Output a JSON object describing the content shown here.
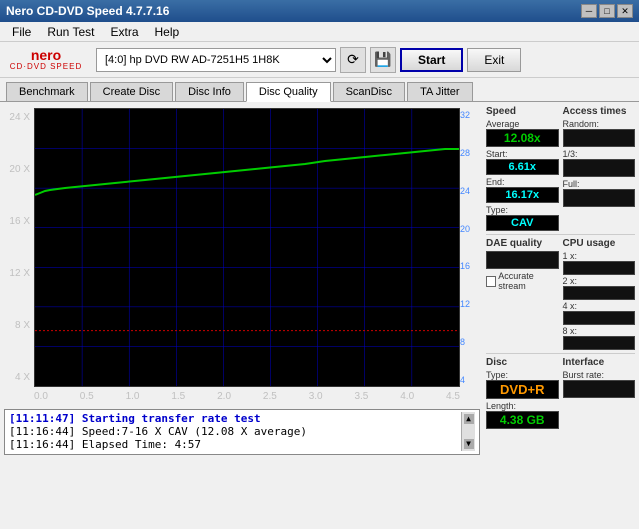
{
  "titleBar": {
    "text": "Nero CD-DVD Speed 4.7.7.16",
    "controls": [
      "minimize",
      "maximize",
      "close"
    ]
  },
  "menuBar": {
    "items": [
      "File",
      "Run Test",
      "Extra",
      "Help"
    ]
  },
  "toolbar": {
    "logo": "CD-DVD SPEED",
    "driveLabel": "[4:0]  hp DVD RW AD-7251H5 1H8K",
    "startLabel": "Start",
    "exitLabel": "Exit"
  },
  "tabs": [
    {
      "label": "Benchmark",
      "active": false
    },
    {
      "label": "Create Disc",
      "active": false
    },
    {
      "label": "Disc Info",
      "active": false
    },
    {
      "label": "Disc Quality",
      "active": true
    },
    {
      "label": "ScanDisc",
      "active": false
    },
    {
      "label": "TA Jitter",
      "active": false
    }
  ],
  "chart": {
    "yAxisLeft": [
      "24 X",
      "20 X",
      "16 X",
      "12 X",
      "8 X",
      "4 X"
    ],
    "yAxisRight": [
      "32",
      "28",
      "24",
      "20",
      "16",
      "12",
      "8",
      "4"
    ],
    "xAxisLabels": [
      "0.0",
      "0.5",
      "1.0",
      "1.5",
      "2.0",
      "2.5",
      "3.0",
      "3.5",
      "4.0",
      "4.5"
    ],
    "gridColor": "#004400",
    "lineColor": "#00cc00",
    "redLineColor": "#ff0000",
    "bgColor": "#000000"
  },
  "rightPanel": {
    "speedSection": {
      "title": "Speed",
      "average": {
        "label": "Average",
        "value": "12.08x"
      },
      "start": {
        "label": "Start:",
        "value": "6.61x"
      },
      "end": {
        "label": "End:",
        "value": "16.17x"
      },
      "type": {
        "label": "Type:",
        "value": "CAV"
      }
    },
    "accessTimes": {
      "title": "Access times",
      "random": {
        "label": "Random:",
        "value": ""
      },
      "oneThird": {
        "label": "1/3:",
        "value": ""
      },
      "full": {
        "label": "Full:",
        "value": ""
      }
    },
    "cpuUsage": {
      "title": "CPU usage",
      "1x": {
        "label": "1 x:",
        "value": ""
      },
      "2x": {
        "label": "2 x:",
        "value": ""
      },
      "4x": {
        "label": "4 x:",
        "value": ""
      },
      "8x": {
        "label": "8 x:",
        "value": ""
      }
    },
    "daeQuality": {
      "title": "DAE quality",
      "value": "",
      "accurateStream": {
        "label": "Accurate stream",
        "checked": false
      }
    },
    "disc": {
      "title": "Disc",
      "type": {
        "label": "Type:",
        "value": "DVD+R"
      },
      "length": {
        "label": "Length:",
        "value": "4.38 GB"
      }
    },
    "interface": {
      "title": "Interface",
      "burstRate": {
        "label": "Burst rate:",
        "value": ""
      }
    }
  },
  "log": {
    "lines": [
      {
        "text": "[11:11:47]  Starting transfer rate test",
        "bold": true
      },
      {
        "text": "[11:16:44]  Speed:7-16 X CAV (12.08 X average)",
        "bold": false
      },
      {
        "text": "[11:16:44]  Elapsed Time: 4:57",
        "bold": false
      }
    ]
  }
}
